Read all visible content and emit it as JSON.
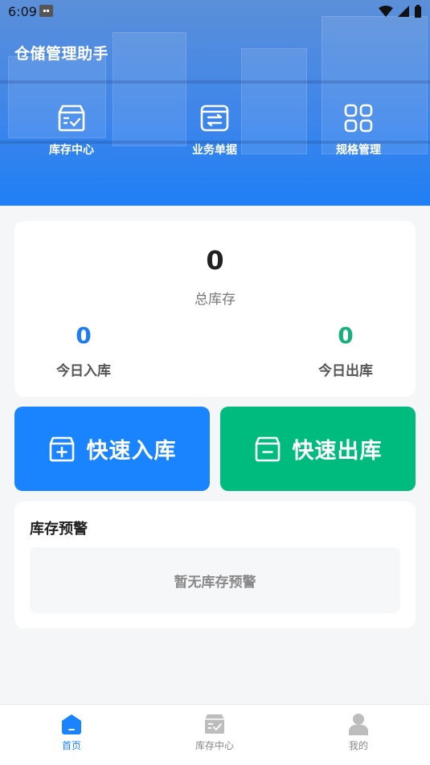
{
  "status_bar": {
    "time": "6:09"
  },
  "header": {
    "app_title": "仓储管理助手",
    "nav": [
      {
        "label": "库存中心",
        "icon": "inventory-box-icon"
      },
      {
        "label": "业务单据",
        "icon": "exchange-document-icon"
      },
      {
        "label": "规格管理",
        "icon": "grid-icon"
      }
    ]
  },
  "stats": {
    "total_value": "0",
    "total_label": "总库存",
    "in_value": "0",
    "in_label": "今日入库",
    "out_value": "0",
    "out_label": "今日出库"
  },
  "actions": {
    "inbound_label": "快速入库",
    "outbound_label": "快速出库"
  },
  "warning": {
    "title": "库存预警",
    "empty_text": "暂无库存预警"
  },
  "tabbar": {
    "tabs": [
      {
        "label": "首页",
        "icon": "home-icon",
        "active": true
      },
      {
        "label": "库存中心",
        "icon": "inventory-box-icon",
        "active": false
      },
      {
        "label": "我的",
        "icon": "user-icon",
        "active": false
      }
    ]
  },
  "colors": {
    "primary": "#1a84ff",
    "success": "#00bb7e",
    "inactive": "#bdbdbd"
  }
}
